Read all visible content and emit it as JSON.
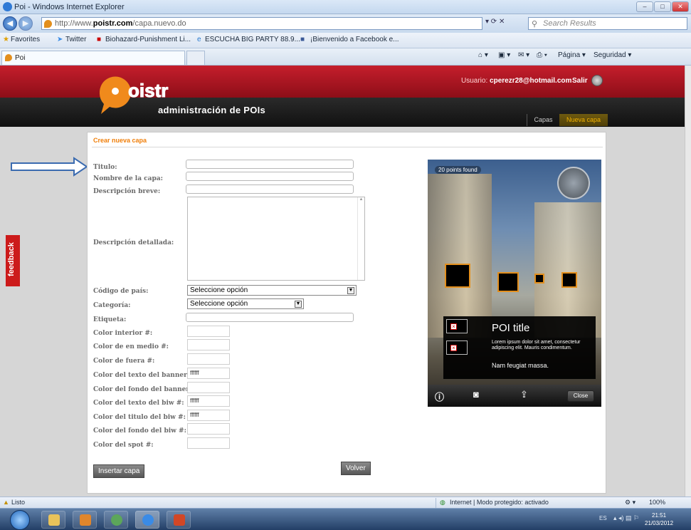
{
  "window": {
    "title": "Poi - Windows Internet Explorer"
  },
  "address_bar": {
    "url_prefix": "http://www.",
    "url_domain": "poistr.com",
    "url_path": "/capa.nuevo.do",
    "search_placeholder": "Search Results"
  },
  "favorites_bar": {
    "favorites_label": "Favorites",
    "items": [
      "Twitter",
      "Biohazard-Punishment Li...",
      "ESCUCHA BIG PARTY 88.9...",
      "¡Bienvenido a Facebook e..."
    ]
  },
  "tab": {
    "label": "Poi"
  },
  "command_bar": {
    "page_label": "Página ▾",
    "security_label": "Seguridad ▾"
  },
  "site": {
    "subtitle": "administración de POIs",
    "user_label": "Usuario:",
    "user_email": "cperezr28@hotmail.com",
    "logout_label": "Salir",
    "breadcrumb": [
      "Capas",
      "Nueva capa"
    ],
    "feedback_label": "feedback"
  },
  "form": {
    "heading": "Crear nueva capa",
    "fields": {
      "titulo": "Titulo:",
      "nombre_capa": "Nombre de la capa:",
      "descripcion_breve": "Descripción breve:",
      "descripcion_detallada": "Descripción detallada:",
      "codigo_pais": "Código de país:",
      "categoria": "Categoría:",
      "etiqueta": "Etiqueta:",
      "color_interior": "Color interior #:",
      "color_en_medio": "Color de en medio #:",
      "color_fuera": "Color de fuera #:",
      "color_texto_banner": "Color del texto del banner #:",
      "color_fondo_banner": "Color del fondo del banner #:",
      "color_texto_biw": "Color del texto del biw #:",
      "color_titulo_biw": "Color del titulo del biw #:",
      "color_fondo_biw": "Color del fondo del biw #:",
      "color_spot": "Color del spot #:"
    },
    "values": {
      "color_texto_banner": "ffffff",
      "color_texto_biw": "ffffff",
      "color_titulo_biw": "ffffff"
    },
    "select_placeholder": "Seleccione opción",
    "insert_button": "Insertar capa",
    "back_button": "Volver"
  },
  "preview": {
    "points_found": "20 points found",
    "poi_title": "POI title",
    "poi_desc": "Lorem ipsum dolor sit amet, consectetur adipiscing elit. Mauris condimentum.",
    "poi_desc2": "Nam feugiat massa.",
    "close_label": "Close"
  },
  "status_bar": {
    "status": "Listo",
    "zone": "Internet | Modo protegido: activado",
    "zoom": "100%"
  },
  "taskbar": {
    "lang": "ES",
    "time": "21:51",
    "date": "21/03/2012"
  },
  "colors": {
    "brand_red": "#c51e2c",
    "accent_orange": "#f07f0a",
    "crumb_active": "#f2b100"
  }
}
